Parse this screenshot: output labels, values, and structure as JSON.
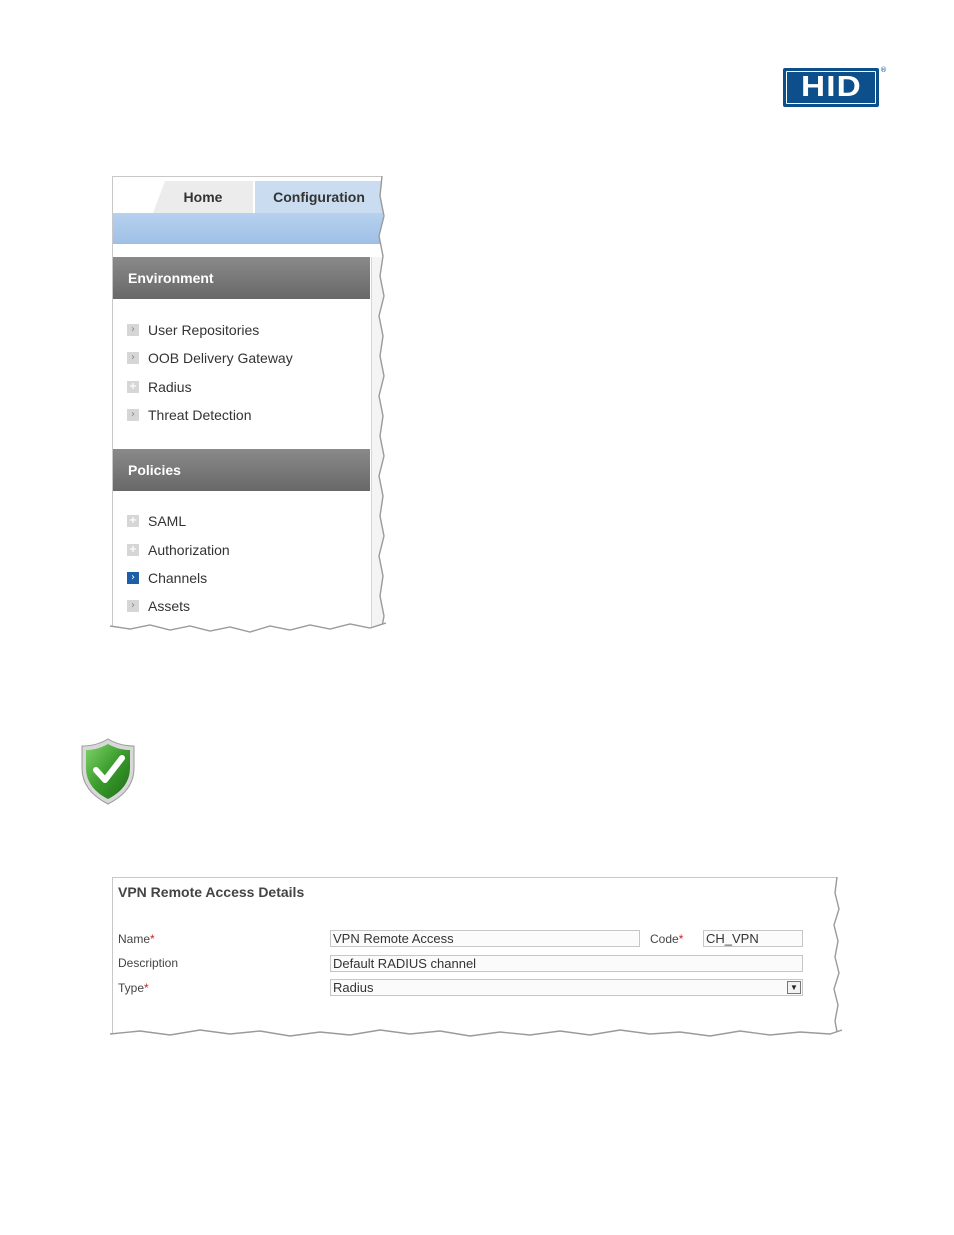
{
  "logo": {
    "text": "HID",
    "registered": "®"
  },
  "nav": {
    "tabs": [
      {
        "label": "Home"
      },
      {
        "label": "Configuration"
      }
    ],
    "sections": [
      {
        "title": "Environment",
        "items": [
          {
            "label": "User Repositories",
            "icon": "arrow-icon"
          },
          {
            "label": "OOB Delivery Gateway",
            "icon": "arrow-icon"
          },
          {
            "label": "Radius",
            "icon": "plus-icon"
          },
          {
            "label": "Threat Detection",
            "icon": "arrow-icon"
          }
        ]
      },
      {
        "title": "Policies",
        "items": [
          {
            "label": "SAML",
            "icon": "plus-icon"
          },
          {
            "label": "Authorization",
            "icon": "plus-icon"
          },
          {
            "label": "Channels",
            "icon": "arrow-icon",
            "active": true
          },
          {
            "label": "Assets",
            "icon": "arrow-icon"
          }
        ]
      }
    ]
  },
  "shield": {
    "icon": "check-shield-icon",
    "color": "#3a9b2c"
  },
  "details": {
    "title": "VPN Remote Access Details",
    "name_label": "Name",
    "name_value": "VPN Remote Access",
    "code_label": "Code",
    "code_value": "CH_VPN",
    "description_label": "Description",
    "description_value": "Default RADIUS channel",
    "type_label": "Type",
    "type_value": "Radius",
    "required_mark": "*"
  },
  "colors": {
    "brand": "#0d4f8b",
    "tab_active": "#c9dcf0",
    "section_header": "#787878",
    "active_icon": "#1c5ea8"
  }
}
